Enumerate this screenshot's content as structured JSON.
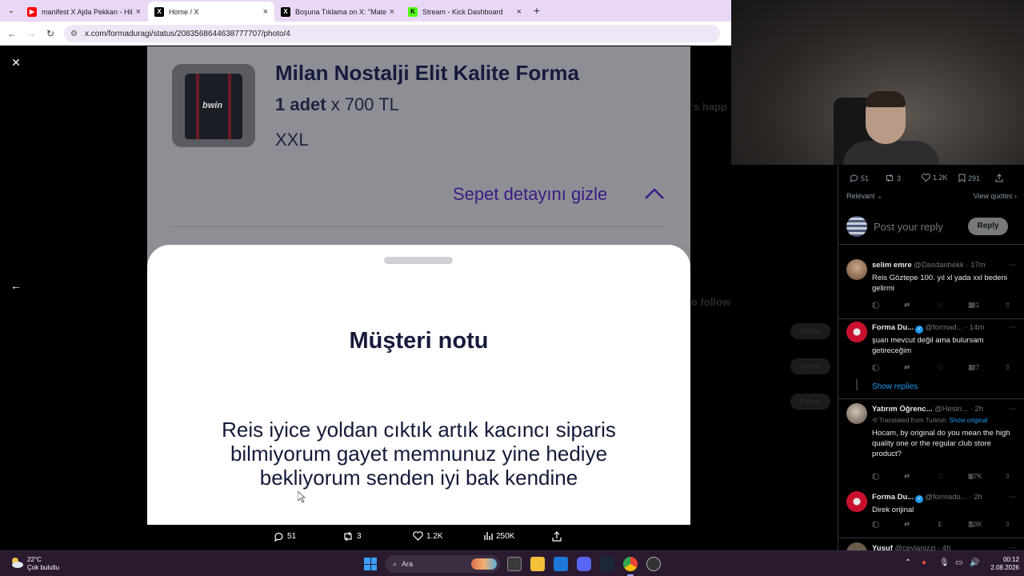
{
  "browser": {
    "tabs": [
      {
        "title": "manifest X Ajda Pekkan - Hileli",
        "icon": "youtube-icon",
        "active": false
      },
      {
        "title": "Home / X",
        "icon": "x-icon",
        "active": true
      },
      {
        "title": "Boşuna Tıklama on X: \"Matema",
        "icon": "x-icon",
        "active": false
      },
      {
        "title": "Stream - Kick Dashboard",
        "icon": "kick-icon",
        "active": false
      }
    ],
    "url": "x.com/formaduragi/status/2083568644638777707/photo/4"
  },
  "photo": {
    "product_title": "Milan Nostalji Elit Kalite Forma",
    "qty_bold": "1 adet",
    "qty_price": " x 700 TL",
    "size": "XXL",
    "hide_cart": "Sepet detayını gizle",
    "sheet_title": "Müşteri notu",
    "sheet_note": "Reis iyice yoldan cıktık artık kacıncı siparis bilmiyorum gayet memnunuz yine hediye bekliyorum senden iyi bak kendine"
  },
  "viewer_actions": {
    "replies": "51",
    "reposts": "3",
    "likes": "1.2K",
    "views": "250K"
  },
  "panel": {
    "stats": {
      "replies": "51",
      "reposts": "3",
      "likes": "1.2K",
      "bookmarks": "291"
    },
    "sort": "Relevant",
    "view_quotes": "View quotes",
    "reply_placeholder": "Post your reply",
    "reply_button": "Reply",
    "show_replies": "Show replies",
    "tweets": [
      {
        "name": "selim emre",
        "handle": "@Dasdanbekk · 17m",
        "text": "Reis Göztepe 100. yıl xl yada xxl bedeni gelirmi",
        "replies": "1",
        "reposts": "",
        "likes": "",
        "views": "381"
      },
      {
        "name": "Forma Du...",
        "handle": "@formad... · 14m",
        "text": "şuan mevcut değil ama bulursam getireceğim",
        "replies": "1",
        "reposts": "",
        "likes": "",
        "views": "337"
      },
      {
        "name": "Yatırım Öğrenc...",
        "handle": "@Hesln... · 2h",
        "translated": "Translated from Turkish",
        "show_original": "Show original",
        "text": "Hocam, by original do you mean the high quality one or the regular club store product?",
        "replies": "1",
        "reposts": "",
        "likes": "",
        "views": "6.7K"
      },
      {
        "name": "Forma Du...",
        "handle": "@formadu... · 2h",
        "text": "Direk orijinal",
        "replies": "1",
        "reposts": "",
        "likes": "1",
        "views": "7.3K"
      },
      {
        "name": "Yusuf",
        "handle": "@ceylanizzi · 4h",
        "text": "",
        "replies": "",
        "reposts": "",
        "likes": "",
        "views": ""
      }
    ]
  },
  "taskbar": {
    "temp": "22°C",
    "weather": "Çok bulutlu",
    "search_placeholder": "Ara",
    "time": "00:12",
    "date": "2.08.2026"
  },
  "colors": {
    "tab_bar": "#e9d8f5",
    "hide_cart_link": "#3d1a85",
    "x_blue": "#1d9bf0",
    "taskbar": "#2a1a30"
  }
}
